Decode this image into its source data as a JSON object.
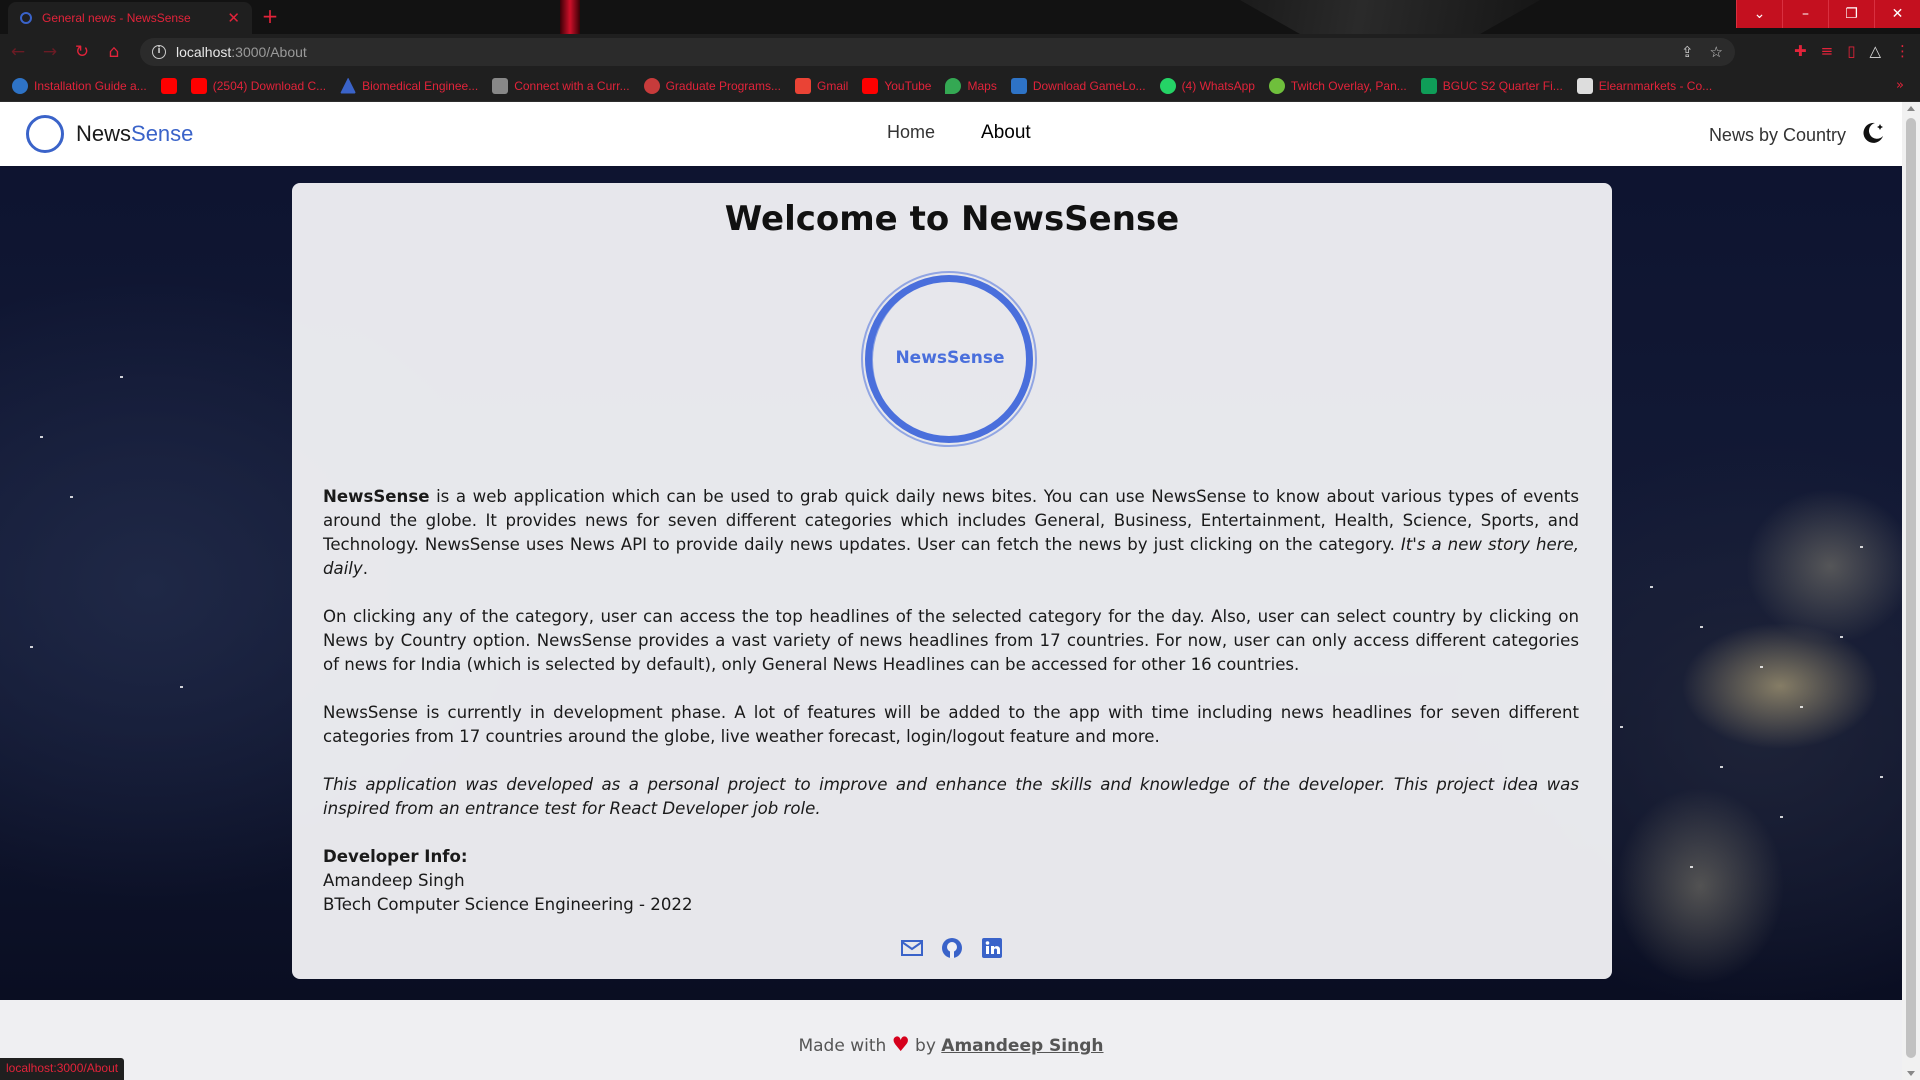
{
  "browser": {
    "tab_title": "General news - NewsSense",
    "url_host": "localhost",
    "url_path": ":3000/About",
    "bookmarks": [
      {
        "label": "Installation Guide a...",
        "color": "#2e73c6"
      },
      {
        "label": "",
        "color": "#ff0000"
      },
      {
        "label": "(2504) Download C...",
        "color": "#ff0000"
      },
      {
        "label": "Biomedical Enginee...",
        "color": "#3a63c9"
      },
      {
        "label": "Connect with a Curr...",
        "color": "#888888"
      },
      {
        "label": "Graduate Programs...",
        "color": "#c73b3b"
      },
      {
        "label": "Gmail",
        "color": "#ea4335"
      },
      {
        "label": "YouTube",
        "color": "#ff0000"
      },
      {
        "label": "Maps",
        "color": "#34a853"
      },
      {
        "label": "Download GameLo...",
        "color": "#2e73c6"
      },
      {
        "label": "(4) WhatsApp",
        "color": "#25d366"
      },
      {
        "label": "Twitch Overlay, Pan...",
        "color": "#6fbf3c"
      },
      {
        "label": "BGUC S2 Quarter Fi...",
        "color": "#0f9d58"
      },
      {
        "label": "Elearnmarkets - Co...",
        "color": "#dddddd"
      }
    ],
    "bookmarks_more": "»",
    "status_url": "localhost:3000/About"
  },
  "navbar": {
    "brand_part1": "News",
    "brand_part2": "Sense",
    "links": [
      "Home",
      "About"
    ],
    "country": "News by Country"
  },
  "about": {
    "title": "Welcome to NewsSense",
    "logo_text": "NewsSense",
    "p1_bold": "NewsSense",
    "p1_text": " is a web application which can be used to grab quick daily news bites. You can use NewsSense to know about various types of events around the globe. It provides news for seven different categories which includes General, Business, Entertainment, Health, Science, Sports, and Technology. NewsSense uses News API to provide daily news updates. User can fetch the news by just clicking on the category. ",
    "p1_italic": "It's a new story here, daily",
    "p1_end": ".",
    "p2": "On clicking any of the category, user can access the top headlines of the selected category for the day. Also, user can select country by clicking on News by Country option. NewsSense provides a vast variety of news headlines from 17 countries. For now, user can only access different categories of news for India (which is selected by default), only General News Headlines can be accessed for other 16 countries.",
    "p3": "NewsSense is currently in development phase. A lot of features will be added to the app with time including news headlines for seven different categories from 17 countries around the globe, live weather forecast, login/logout feature and more.",
    "p4": "This application was developed as a personal project to improve and enhance the skills and knowledge of the developer. This project idea was inspired from an entrance test for React Developer job role.",
    "dev_heading": "Developer Info:",
    "dev_name": "Amandeep Singh",
    "dev_degree": "BTech Computer Science Engineering - 2022",
    "social_icons": [
      "mail-icon",
      "github-icon",
      "linkedin-icon"
    ]
  },
  "footer": {
    "made_with": "Made with",
    "heart": "♥",
    "by": "by",
    "author": "Amandeep Singh"
  },
  "colors": {
    "accent": "#3a63c9",
    "browser_accent": "#e2233a",
    "heart": "#d6001c"
  }
}
